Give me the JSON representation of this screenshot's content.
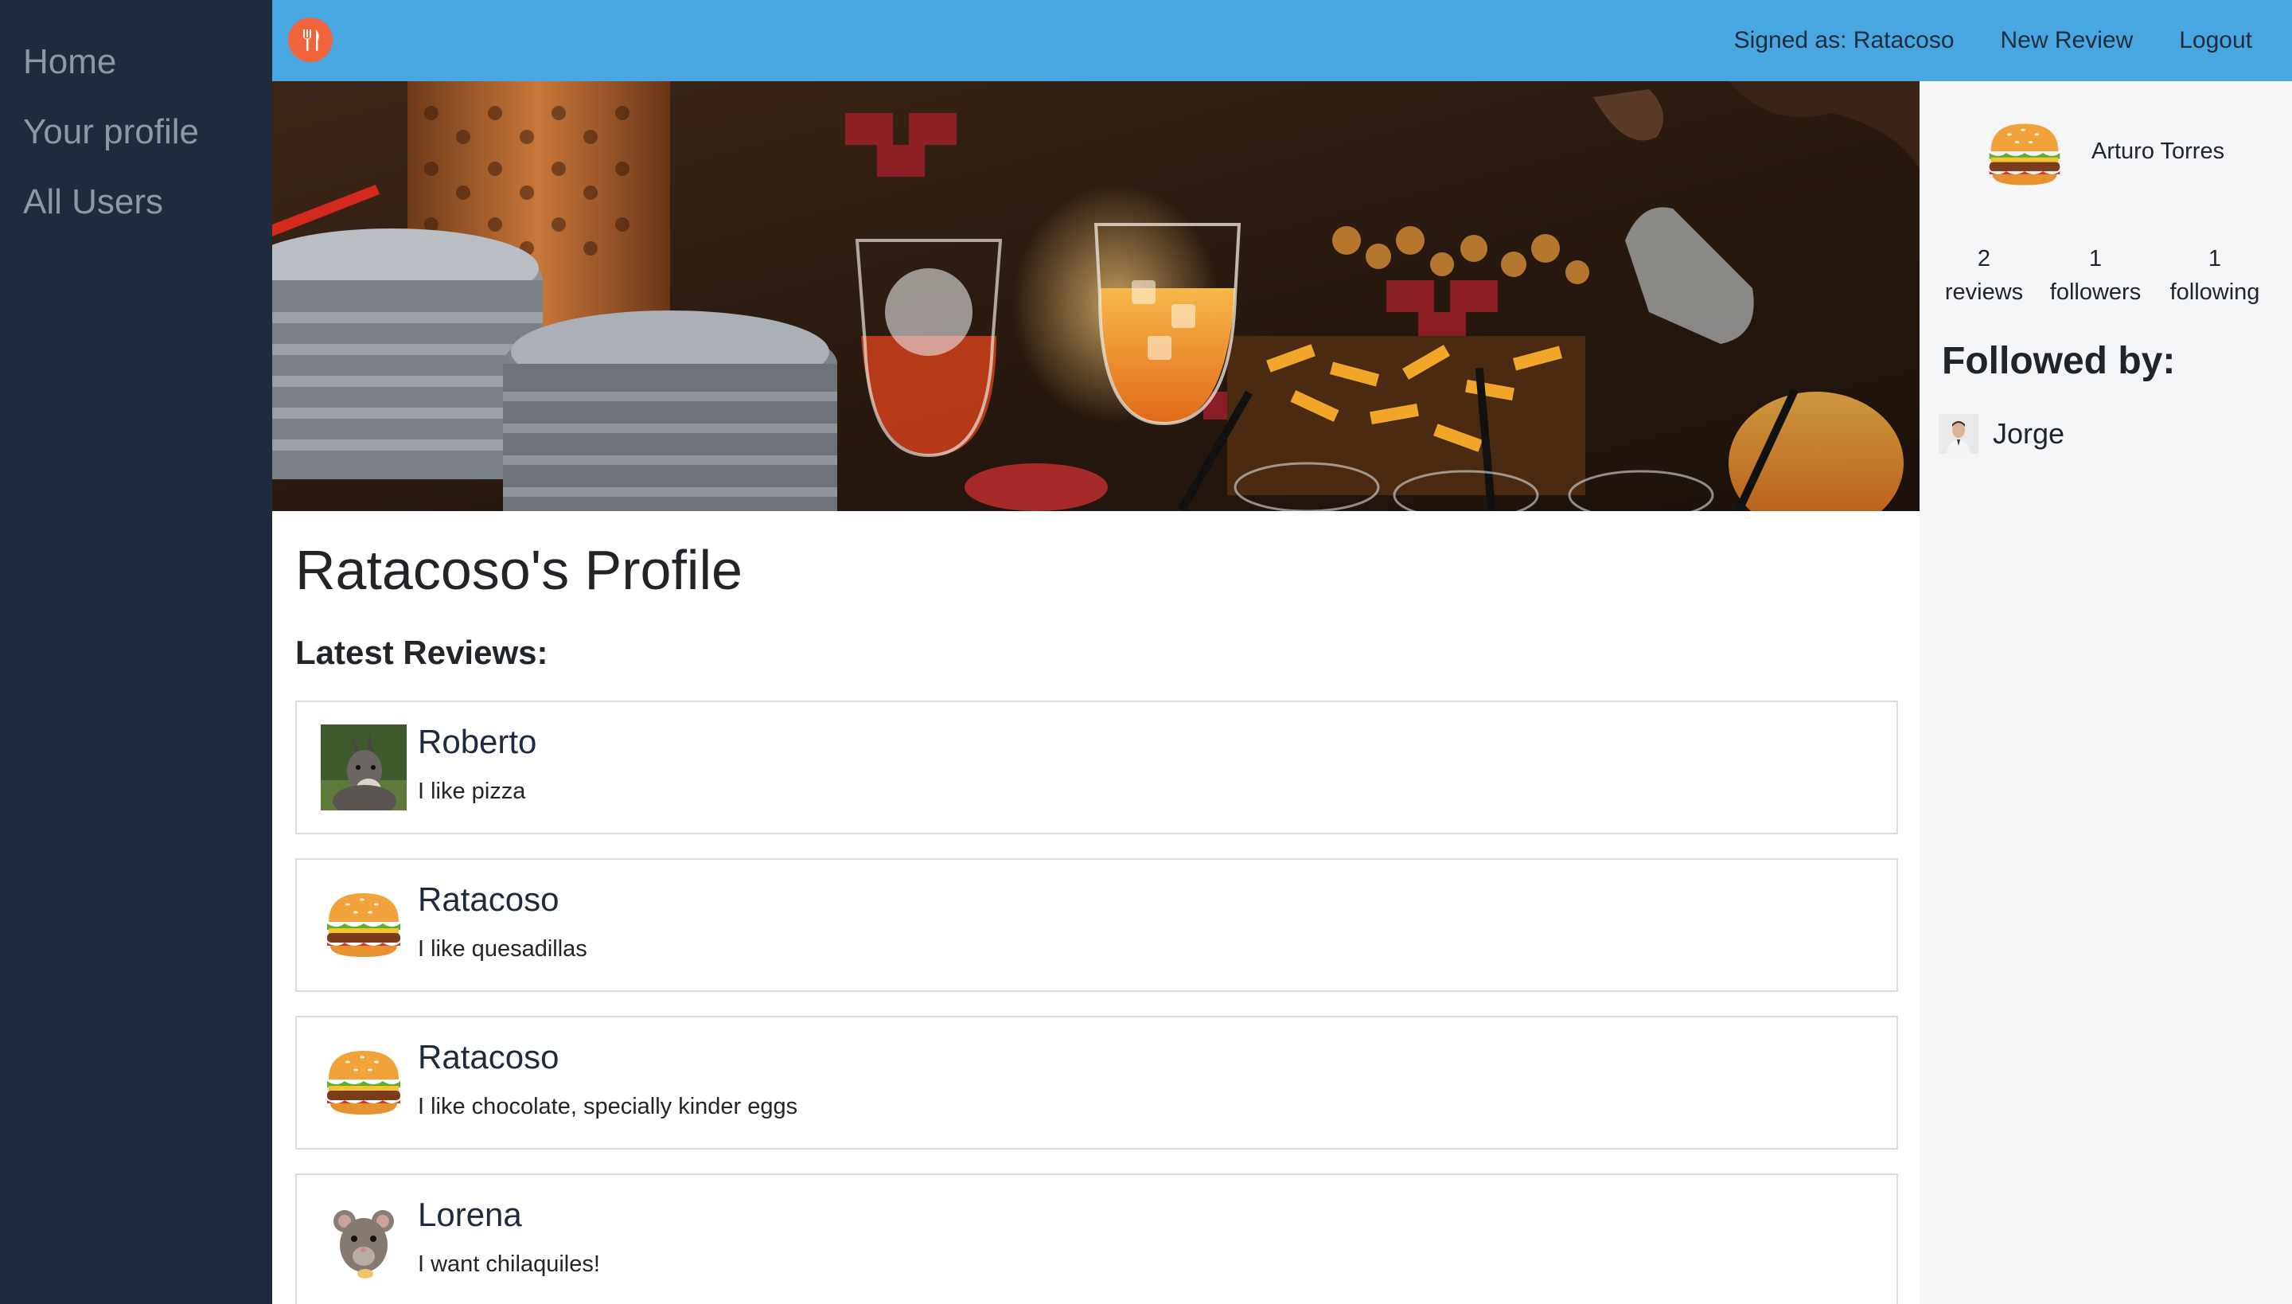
{
  "sidebar": {
    "items": [
      {
        "label": "Home"
      },
      {
        "label": "Your profile"
      },
      {
        "label": "All Users"
      }
    ]
  },
  "navbar": {
    "brand_icon": "fork-knife-icon",
    "brand_color": "#f0643c",
    "background": "#48a6e0",
    "signed_as": "Signed as: Ratacoso",
    "new_review": "New Review",
    "logout": "Logout"
  },
  "profile": {
    "title": "Ratacoso's Profile",
    "latest_reviews_heading": "Latest Reviews:"
  },
  "reviews": [
    {
      "author": "Roberto",
      "text": "I like pizza",
      "avatar": "donkey-avatar"
    },
    {
      "author": "Ratacoso",
      "text": "I like quesadillas",
      "avatar": "burger-avatar"
    },
    {
      "author": "Ratacoso",
      "text": "I like chocolate, specially kinder eggs",
      "avatar": "burger-avatar"
    },
    {
      "author": "Lorena",
      "text": "I want chilaquiles!",
      "avatar": "mouse-avatar"
    }
  ],
  "user_card": {
    "name": "Arturo Torres",
    "avatar": "burger-avatar",
    "stats": [
      {
        "value": "2",
        "label": "reviews"
      },
      {
        "value": "1",
        "label": "followers"
      },
      {
        "value": "1",
        "label": "following"
      }
    ],
    "followed_by_heading": "Followed by:",
    "followers": [
      {
        "name": "Jorge",
        "avatar": "person-avatar"
      }
    ]
  }
}
